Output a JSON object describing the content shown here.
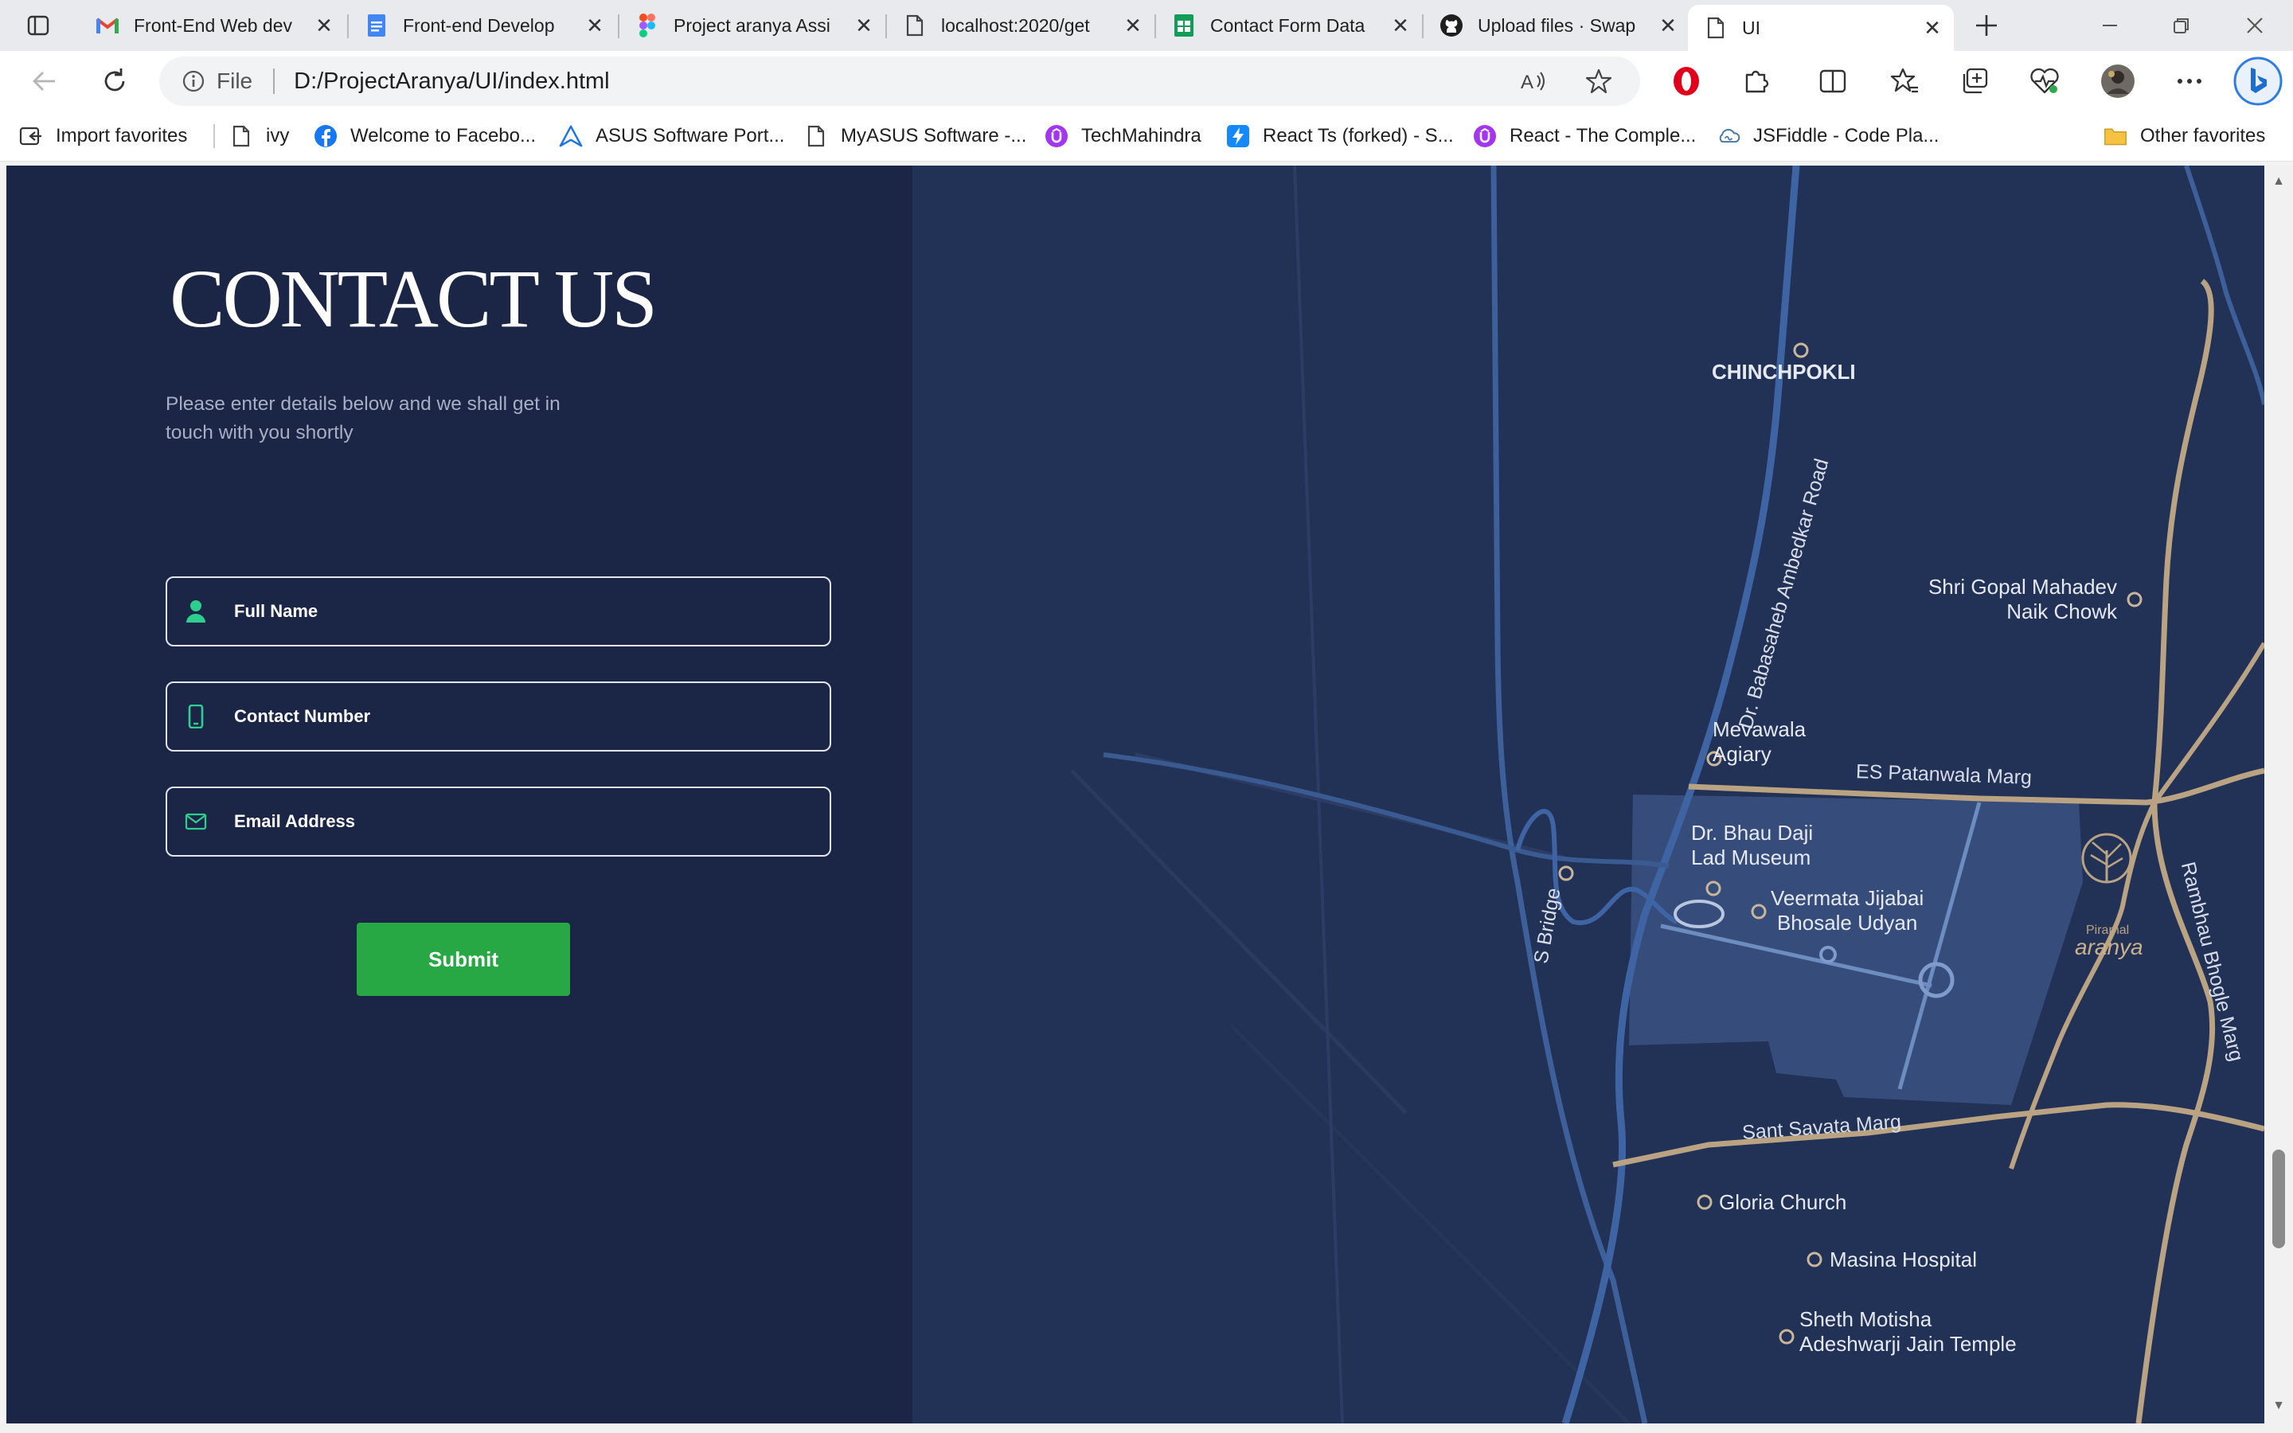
{
  "tabs": [
    {
      "title": "Front-End Web dev",
      "icon": "gmail-icon"
    },
    {
      "title": "Front-end Develop",
      "icon": "docs-icon"
    },
    {
      "title": "Project aranya Assi",
      "icon": "figma-icon"
    },
    {
      "title": "localhost:2020/get",
      "icon": "page-icon"
    },
    {
      "title": "Contact Form Data",
      "icon": "sheets-icon"
    },
    {
      "title": "Upload files · Swap",
      "icon": "github-icon"
    },
    {
      "title": "UI",
      "icon": "page-icon"
    }
  ],
  "address_bar": {
    "site_info": "File",
    "url": "D:/ProjectAranya/UI/index.html"
  },
  "favorites": [
    {
      "label": "Import favorites",
      "icon": "import-icon"
    },
    {
      "label": "ivy",
      "icon": "page-icon"
    },
    {
      "label": "Welcome to Facebo...",
      "icon": "facebook-icon"
    },
    {
      "label": "ASUS Software Port...",
      "icon": "asus-icon"
    },
    {
      "label": "MyASUS Software -...",
      "icon": "page-icon"
    },
    {
      "label": "TechMahindra",
      "icon": "udemy-icon"
    },
    {
      "label": "React Ts (forked) - S...",
      "icon": "stackblitz-icon"
    },
    {
      "label": "React - The Comple...",
      "icon": "udemy-icon"
    },
    {
      "label": "JSFiddle - Code Pla...",
      "icon": "jsfiddle-icon"
    },
    {
      "label": "Other favorites",
      "icon": "folder-icon"
    }
  ],
  "contact": {
    "title": "CONTACT US",
    "subtitle": "Please enter details below and we shall get in touch with you shortly",
    "fields": [
      {
        "label": "Full Name",
        "icon": "user-icon"
      },
      {
        "label": "Contact Number",
        "icon": "phone-icon"
      },
      {
        "label": "Email Address",
        "icon": "mail-icon"
      }
    ],
    "submit_label": "Submit"
  },
  "map": {
    "places": [
      "CHINCHPOKLI",
      "Shri Gopal Mahadev\nNaik Chowk",
      "Mevawala\nAgiary",
      "Dr. Bhau Daji\nLad Museum",
      "Veermata Jijabai\nBhosale Udyan",
      "Gloria Church",
      "Masina Hospital",
      "Sheth Motisha\nAdeshwarji Jain Temple"
    ],
    "roads": [
      "Dr. Babasaheb Ambedkar Road",
      "ES Patanwala Marg",
      "S Bridge",
      "Rambhau Bhogle Marg",
      "Sant Savata Marg"
    ],
    "logo_text": "aranya",
    "logo_brand": "Piramal"
  },
  "colors": {
    "page_left": "#1b2646",
    "map_bg": "#223156",
    "accent": "#28a745",
    "icon_accent": "#2ecf8e"
  }
}
